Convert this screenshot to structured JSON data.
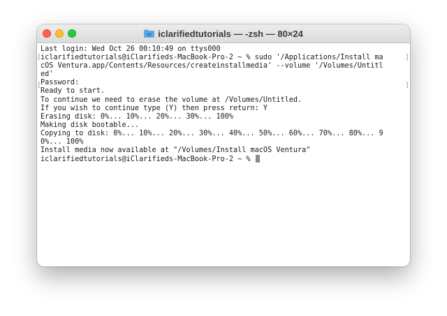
{
  "window": {
    "title": "iclarifiedtutorials — -zsh — 80×24",
    "title_icon": "folder-icon",
    "colors": {
      "close": "#ff5f57",
      "minimize": "#febc2e",
      "zoom": "#28c840",
      "folder": "#5aa9e6"
    }
  },
  "terminal": {
    "lines": [
      "Last login: Wed Oct 26 00:10:49 on ttys000",
      "iclarifiedtutorials@iClarifieds-MacBook-Pro-2 ~ % sudo '/Applications/Install ma",
      "cOS Ventura.app/Contents/Resources/createinstallmedia' --volume '/Volumes/Untitl",
      "ed'",
      "Password:",
      "Ready to start.",
      "To continue we need to erase the volume at /Volumes/Untitled.",
      "If you wish to continue type (Y) then press return: Y",
      "Erasing disk: 0%... 10%... 20%... 30%... 100%",
      "Making disk bootable...",
      "Copying to disk: 0%... 10%... 20%... 30%... 40%... 50%... 60%... 70%... 80%... 9",
      "0%... 100%",
      "Install media now available at \"/Volumes/Install macOS Ventura\"",
      "iclarifiedtutorials@iClarifieds-MacBook-Pro-2 ~ % "
    ]
  }
}
